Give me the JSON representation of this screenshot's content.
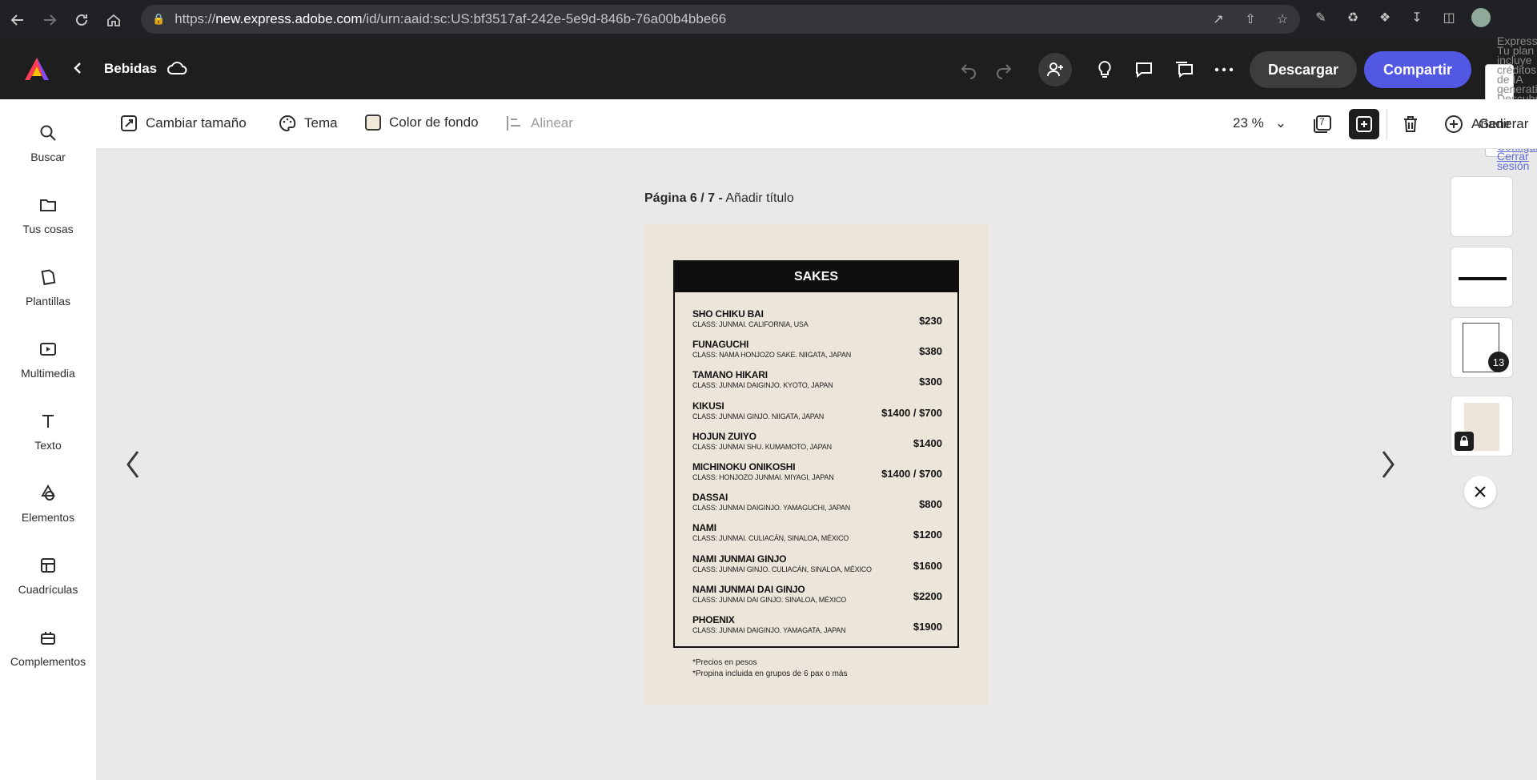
{
  "browser": {
    "url_prefix": "https://",
    "url_host": "new.express.adobe.com",
    "url_path": "/id/urn:aaid:sc:US:bf3517af-242e-5e9d-846b-76a00b4bbe66"
  },
  "header": {
    "doc_title": "Bebidas",
    "download_label": "Descargar",
    "share_label": "Compartir",
    "overflow_text": "Express Tu plan incluye créditos de IA generativa. Descubre cómo funcionan los créditos",
    "overflow_links": [
      "Configuración",
      "Cerrar sesión"
    ]
  },
  "rail": {
    "items": [
      {
        "label": "Buscar"
      },
      {
        "label": "Tus cosas"
      },
      {
        "label": "Plantillas"
      },
      {
        "label": "Multimedia"
      },
      {
        "label": "Texto"
      },
      {
        "label": "Elementos"
      },
      {
        "label": "Cuadrículas"
      },
      {
        "label": "Complementos"
      }
    ]
  },
  "toolbar": {
    "resize_label": "Cambiar tamaño",
    "theme_label": "Tema",
    "bg_color_label": "Color de fondo",
    "align_label": "Alinear",
    "zoom_value": "23 %",
    "layers_count": "7",
    "add_label": "Añadir",
    "generate_label": "Generar"
  },
  "canvas": {
    "page_number": "Página 6 / 7 -",
    "page_title_placeholder": "Añadir título"
  },
  "menu": {
    "heading": "SAKES",
    "items": [
      {
        "name": "SHO CHIKU BAI",
        "class": "CLASS: JUNMAI. CALIFORNIA, USA",
        "price": "$230"
      },
      {
        "name": "FUNAGUCHI",
        "class": "CLASS: NAMA HONJOZO SAKE. NIIGATA, JAPAN",
        "price": "$380"
      },
      {
        "name": "TAMANO HIKARI",
        "class": "CLASS: JUNMAI DAIGINJO. KYOTO, JAPAN",
        "price": "$300"
      },
      {
        "name": "KIKUSI",
        "class": "CLASS: JUNMAI GINJO. NIIGATA, JAPAN",
        "price": "$1400 / $700"
      },
      {
        "name": "HOJUN ZUIYO",
        "class": "CLASS: JUNMAI SHU. KUMAMOTO, JAPAN",
        "price": "$1400"
      },
      {
        "name": "MICHINOKU ONIKOSHI",
        "class": "CLASS: HONJOZO JUNMAI. MIYAGI, JAPAN",
        "price": "$1400 / $700"
      },
      {
        "name": "DASSAI",
        "class": "CLASS: JUNMAI DAIGINJO. YAMAGUCHI, JAPAN",
        "price": "$800"
      },
      {
        "name": "NAMI",
        "class": "CLASS: JUNMAI. CULIACÁN, SINALOA, MÉXICO",
        "price": "$1200"
      },
      {
        "name": "NAMI JUNMAI GINJO",
        "class": "CLASS: JUNMAI GINJO. CULIACÁN, SINALOA, MÉXICO",
        "price": "$1600"
      },
      {
        "name": "NAMI JUNMAI DAI GINJO",
        "class": "CLASS: JUNMAI DAI GINJO. SINALOA, MÉXICO",
        "price": "$2200"
      },
      {
        "name": "PHOENIX",
        "class": "CLASS: JUNMAI DAIGINJO. YAMAGATA, JAPAN",
        "price": "$1900"
      }
    ],
    "notes": [
      "*Precios en pesos",
      "*Propina incluida en grupos de 6 pax o más"
    ]
  },
  "thumbnails": {
    "badge_count": "13"
  },
  "colors": {
    "share_button": "#5258e4",
    "app_header": "#1e1e1e",
    "menu_paper": "#ece6da"
  }
}
